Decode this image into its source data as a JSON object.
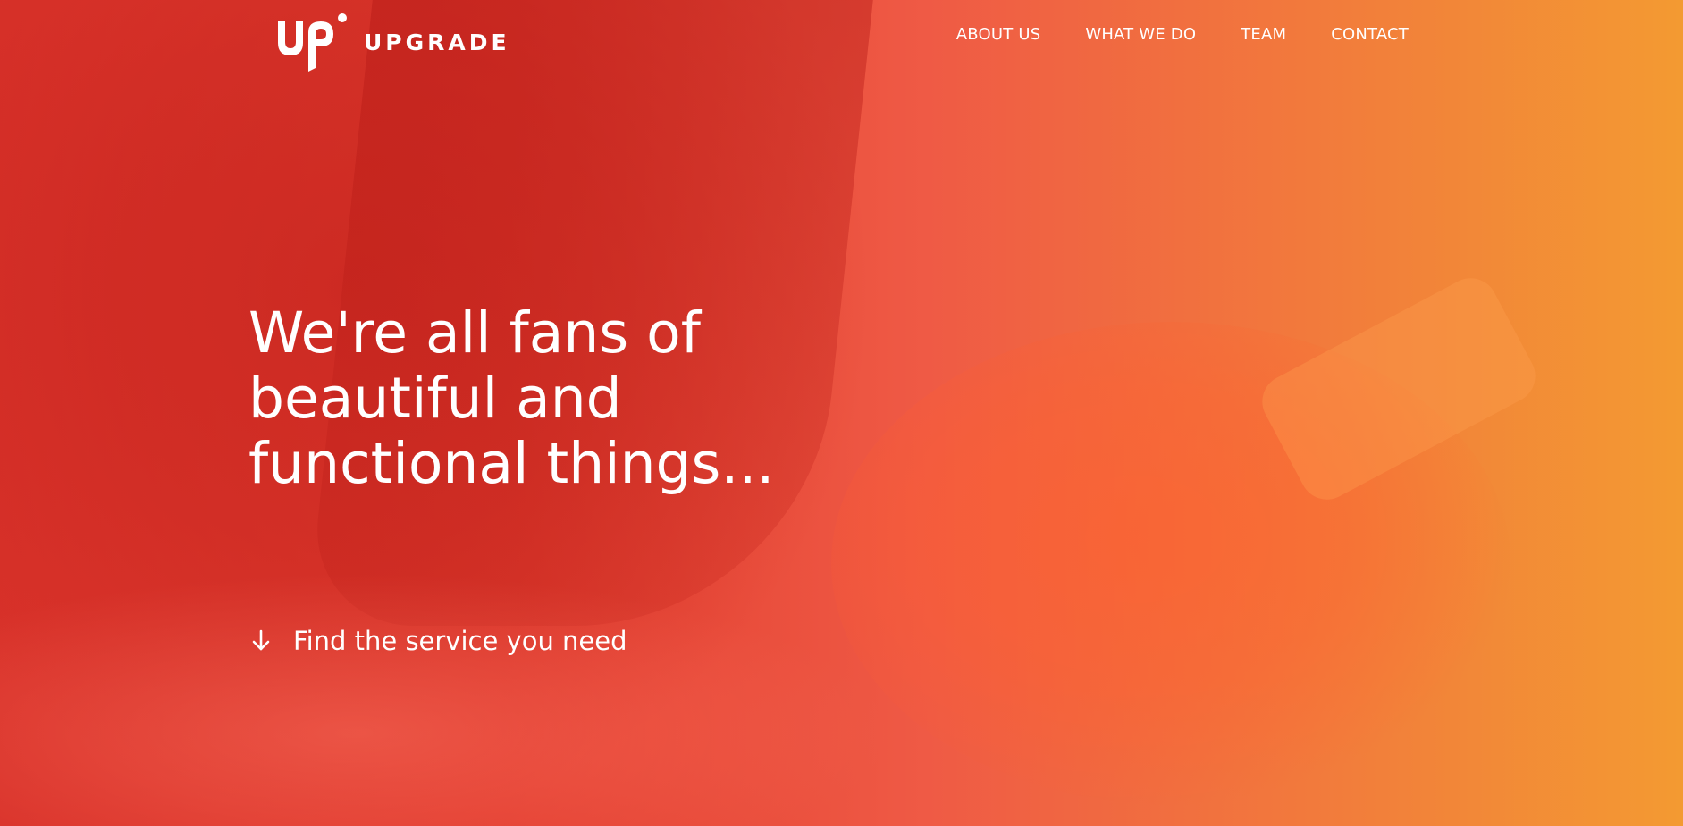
{
  "header": {
    "logo_text": "UPGRADE",
    "nav": [
      {
        "label": "ABOUT US"
      },
      {
        "label": "WHAT WE DO"
      },
      {
        "label": "TEAM"
      },
      {
        "label": "CONTACT"
      }
    ]
  },
  "hero": {
    "headline_lines": [
      "We're all fans of",
      "beautiful and",
      "functional things..."
    ],
    "cta_label": "Find the service you need",
    "cta_icon": "arrow-down-icon"
  },
  "colors": {
    "gradient_left": "#d9322a",
    "gradient_right": "#f39a32",
    "text": "#ffffff"
  }
}
